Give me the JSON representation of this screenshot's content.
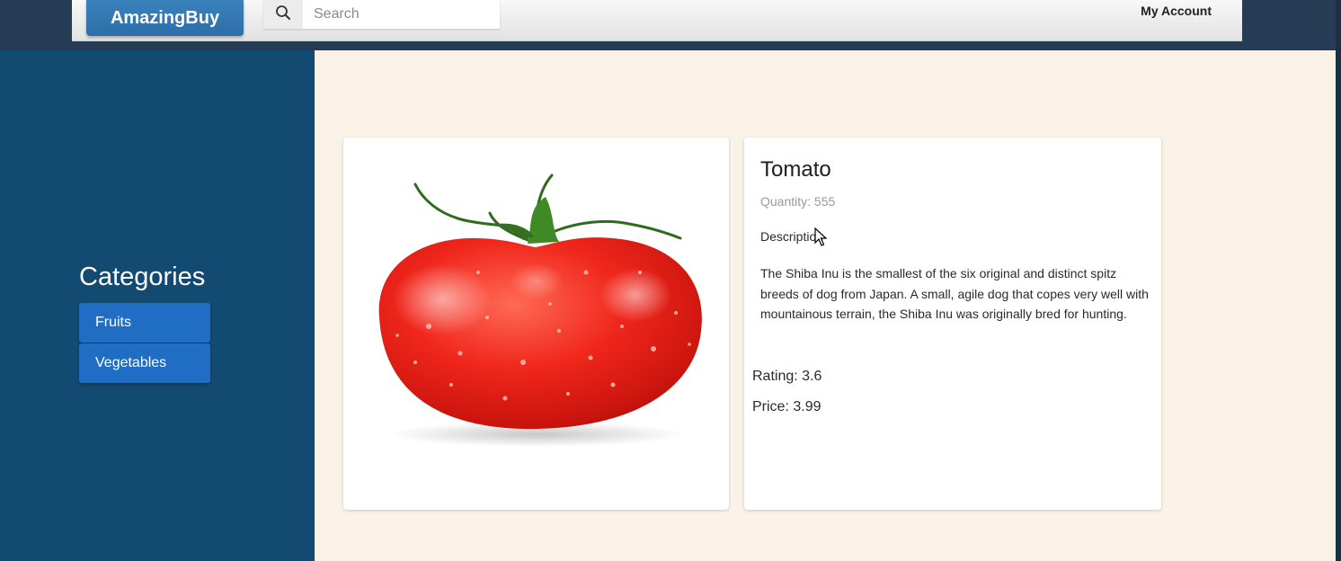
{
  "header": {
    "logo": "AmazingBuy",
    "search": {
      "placeholder": "Search",
      "value": "",
      "icon": "search-icon"
    },
    "account_label": "My Account"
  },
  "sidebar": {
    "title": "Categories",
    "categories": [
      {
        "label": "Fruits"
      },
      {
        "label": "Vegetables"
      }
    ]
  },
  "product": {
    "image": "tomato",
    "name": "Tomato",
    "quantity_text": "Quantity: 555",
    "description_label": "Description",
    "description": "The Shiba Inu is the smallest of the six original and distinct spitz breeds of dog from Japan. A small, agile dog that copes very well with mountainous terrain, the Shiba Inu was originally bred for hunting.",
    "rating_text": "Rating: 3.6",
    "price_text": "Price: 3.99"
  },
  "colors": {
    "sidebar": "#134a72",
    "accent": "#1f6ec4",
    "main_bg": "#faf2e6"
  }
}
